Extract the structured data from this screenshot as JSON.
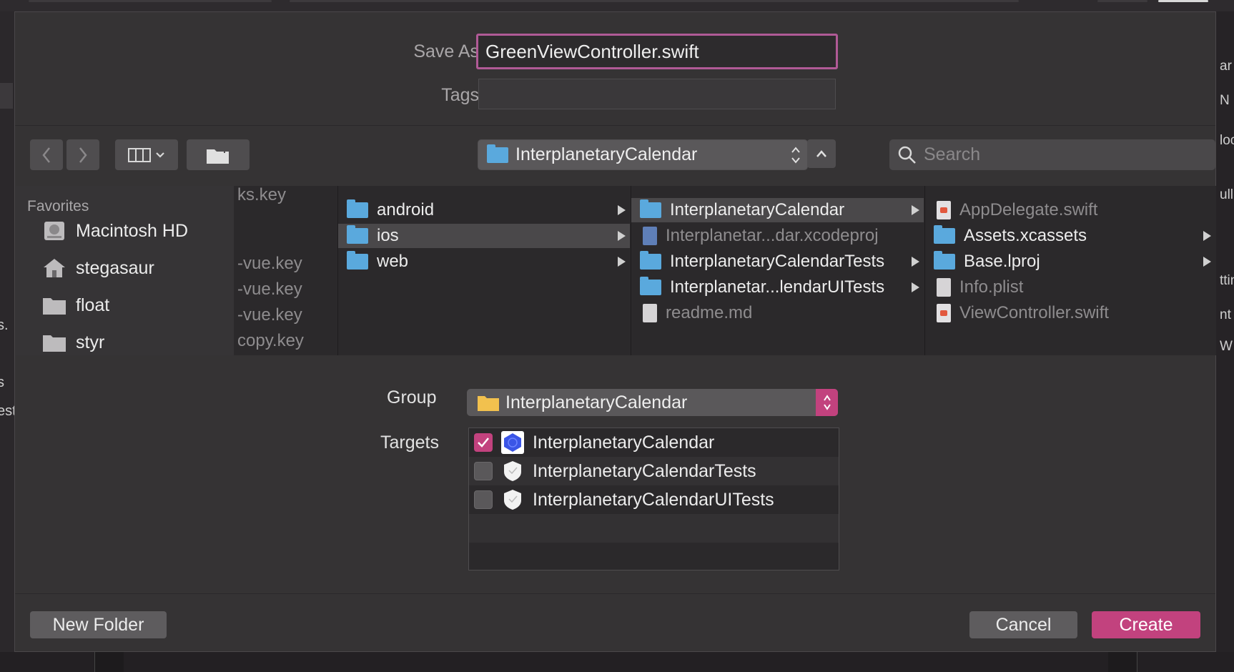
{
  "background": {
    "left_fragments": [
      "s.",
      "s",
      "est"
    ],
    "right_fragments": [
      "ar",
      "N",
      "loc",
      "ull",
      "ttin",
      "nt U",
      "W"
    ]
  },
  "dialog": {
    "save_as_label": "Save As:",
    "save_as_value": "GreenViewController.swift",
    "tags_label": "Tags:",
    "tags_value": "",
    "location": "InterplanetaryCalendar",
    "search_placeholder": "Search"
  },
  "sidebar": {
    "heading": "Favorites",
    "items": [
      {
        "label": "Macintosh HD",
        "icon": "hard-drive-icon"
      },
      {
        "label": "stegasaur",
        "icon": "home-icon"
      },
      {
        "label": "float",
        "icon": "folder-icon"
      },
      {
        "label": "styr",
        "icon": "folder-icon"
      }
    ]
  },
  "columns": [
    {
      "items": [
        {
          "label": "ks.key",
          "dim": true
        },
        {
          "label": "-vue.key",
          "dim": true
        },
        {
          "label": "-vue.key",
          "dim": true
        },
        {
          "label": "-vue.key",
          "dim": true
        },
        {
          "label": "copy.key",
          "dim": true
        }
      ]
    },
    {
      "items": [
        {
          "label": "android",
          "type": "folder",
          "arrow": true
        },
        {
          "label": "ios",
          "type": "folder",
          "arrow": true,
          "selected": true
        },
        {
          "label": "web",
          "type": "folder",
          "arrow": true
        }
      ]
    },
    {
      "items": [
        {
          "label": "InterplanetaryCalendar",
          "type": "folder",
          "arrow": true,
          "selected": true
        },
        {
          "label": "Interplanetar...dar.xcodeproj",
          "type": "project",
          "dim": true
        },
        {
          "label": "InterplanetaryCalendarTests",
          "type": "folder",
          "arrow": true
        },
        {
          "label": "Interplanetar...lendarUITests",
          "type": "folder",
          "arrow": true
        },
        {
          "label": "readme.md",
          "type": "doc",
          "dim": true
        }
      ]
    },
    {
      "items": [
        {
          "label": "AppDelegate.swift",
          "type": "swift",
          "dim": true
        },
        {
          "label": "Assets.xcassets",
          "type": "folder",
          "arrow": true
        },
        {
          "label": "Base.lproj",
          "type": "folder",
          "arrow": true
        },
        {
          "label": "Info.plist",
          "type": "doc",
          "dim": true
        },
        {
          "label": "ViewController.swift",
          "type": "swift",
          "dim": true
        }
      ]
    }
  ],
  "options": {
    "group_label": "Group",
    "group_value": "InterplanetaryCalendar",
    "targets_label": "Targets",
    "targets": [
      {
        "label": "InterplanetaryCalendar",
        "checked": true,
        "icon": "app-target-icon"
      },
      {
        "label": "InterplanetaryCalendarTests",
        "checked": false,
        "icon": "test-target-icon"
      },
      {
        "label": "InterplanetaryCalendarUITests",
        "checked": false,
        "icon": "test-target-icon"
      }
    ]
  },
  "buttons": {
    "new_folder": "New Folder",
    "cancel": "Cancel",
    "create": "Create"
  },
  "colors": {
    "accent": "#c2427e",
    "focus_ring": "#b05a96",
    "folder": "#5aa9dd"
  }
}
